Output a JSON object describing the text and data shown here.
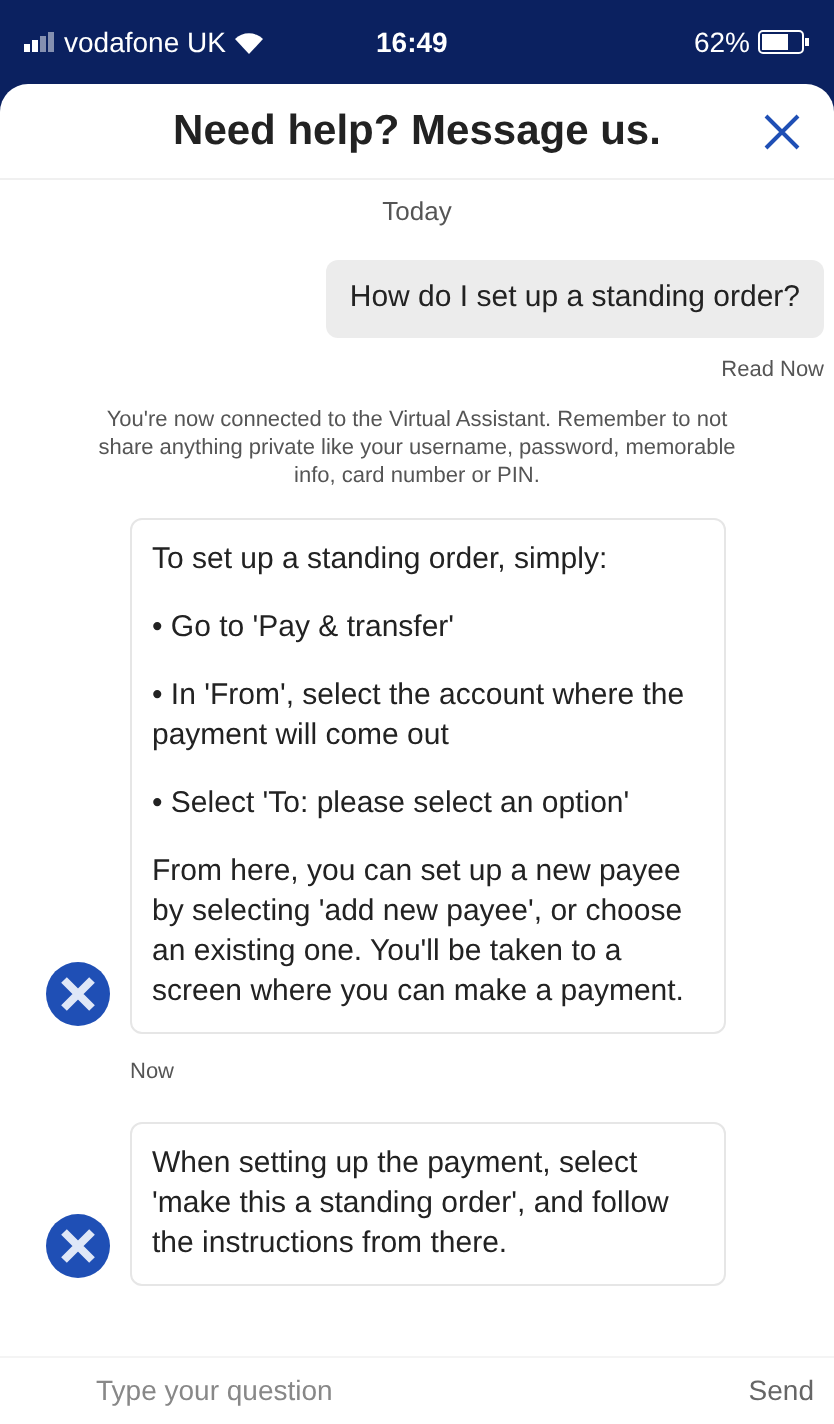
{
  "status_bar": {
    "carrier": "vodafone UK",
    "time": "16:49",
    "battery": "62%"
  },
  "header": {
    "title": "Need help? Message us."
  },
  "day_label": "Today",
  "messages": [
    {
      "kind": "user",
      "text": "How do I set up a standing order?",
      "receipt": "Read Now"
    },
    {
      "kind": "notice",
      "text": "You're now connected to the Virtual Assistant. Remember to not share anything private like your username, password, memorable info, card number or PIN."
    },
    {
      "kind": "bot",
      "paragraphs": [
        "To set up a standing order, simply:",
        "• Go to 'Pay & transfer'",
        "• In 'From', select the account where the payment will come out",
        "• Select 'To: please select an option'",
        "From here, you can set up a new payee by selecting 'add new payee', or choose an existing one. You'll be taken to a screen where you can make a payment."
      ],
      "time": "Now"
    },
    {
      "kind": "bot",
      "paragraphs": [
        "When setting up the payment, select 'make this a standing order', and follow the instructions from there."
      ]
    }
  ],
  "composer": {
    "placeholder": "Type your question",
    "send": "Send"
  }
}
